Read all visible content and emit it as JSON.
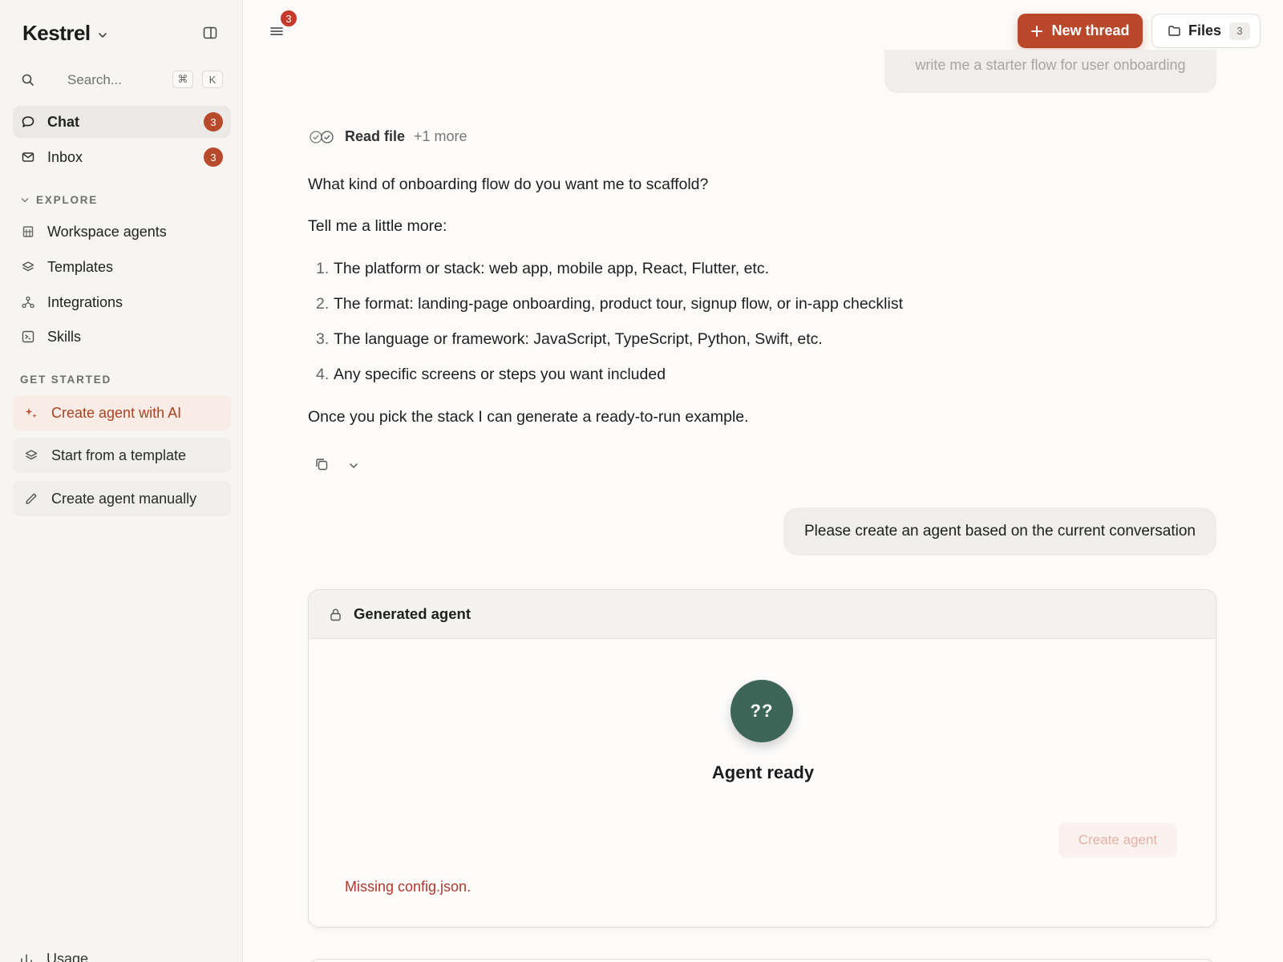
{
  "sidebar": {
    "brand": "Kestrel",
    "search": {
      "placeholder": "Search...",
      "shortcut_mod": "⌘",
      "shortcut_key": "K"
    },
    "nav": [
      {
        "label": "Chat",
        "badge": "3",
        "active": true
      },
      {
        "label": "Inbox",
        "badge": "3"
      }
    ],
    "explore": {
      "heading": "EXPLORE",
      "items": [
        {
          "label": "Workspace agents",
          "icon": "building-icon"
        },
        {
          "label": "Templates",
          "icon": "layers-icon"
        },
        {
          "label": "Integrations",
          "icon": "nodes-icon"
        },
        {
          "label": "Skills",
          "icon": "terminal-icon"
        }
      ]
    },
    "get_started": {
      "heading": "GET STARTED",
      "items": [
        {
          "label": "Create agent with AI",
          "icon": "sparkle-icon"
        },
        {
          "label": "Start from a template",
          "icon": "layers-icon"
        },
        {
          "label": "Create agent manually",
          "icon": "pencil-icon"
        }
      ]
    },
    "usage_label": "Usage"
  },
  "header": {
    "menu_badge": "3",
    "new_thread_label": "New thread",
    "files_label": "Files",
    "files_count": "3"
  },
  "thread": {
    "previous_user_message": "write me a starter flow for user onboarding",
    "tool_activity": {
      "name": "Read file",
      "more": "+1 more"
    },
    "assistant": {
      "intro": "What kind of onboarding flow do you want me to scaffold?",
      "lead": "Tell me a little more:",
      "items": [
        {
          "num": "1.",
          "text": "The platform or stack: web app, mobile app, React, Flutter, etc."
        },
        {
          "num": "2.",
          "text": "The format: landing-page onboarding, product tour, signup flow, or in-app checklist"
        },
        {
          "num": "3.",
          "text": "The language or framework: JavaScript, TypeScript, Python, Swift, etc."
        },
        {
          "num": "4.",
          "text": "Any specific screens or steps you want included"
        }
      ],
      "closing": "Once you pick the stack I can generate a ready-to-run example."
    },
    "user_message": "Please create an agent based on the current conversation",
    "agent_card": {
      "title": "Generated agent",
      "avatar_initials": "??",
      "status": "Agent ready",
      "create_label": "Create agent",
      "error": "Missing config.json."
    }
  },
  "colors": {
    "accent": "#b9482a",
    "badge": "#b74a2a",
    "avatar": "#3d6659",
    "error": "#b0392d"
  }
}
